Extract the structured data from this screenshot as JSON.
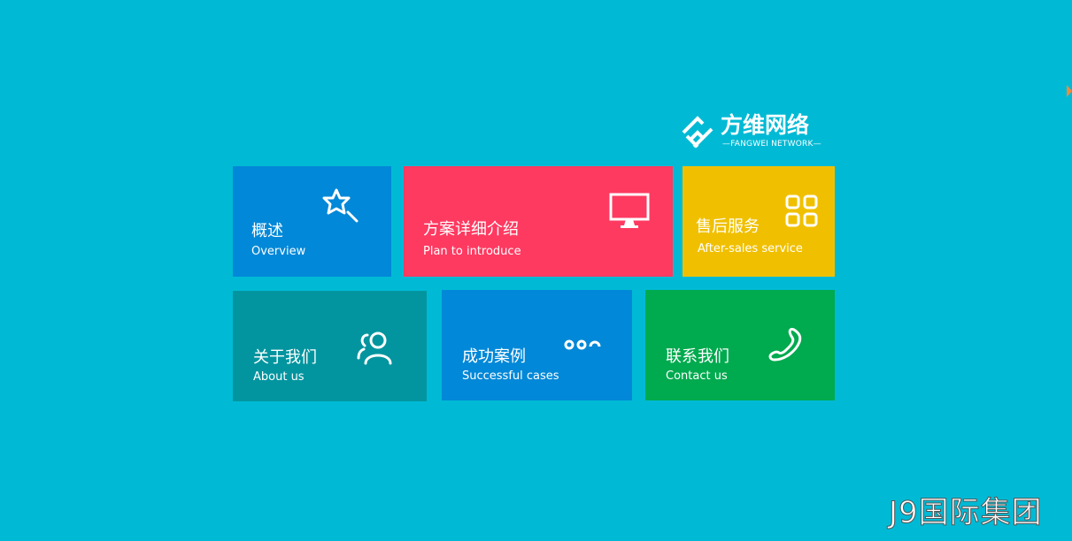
{
  "brand": {
    "name_cn": "方维网络",
    "name_en": "—FANGWEI NETWORK—",
    "accent_color": "#00bad5"
  },
  "tiles": [
    {
      "title": "概述",
      "subtitle": "Overview",
      "icon": "star-magnifier-icon",
      "color": "#0288d8"
    },
    {
      "title": "方案详细介绍",
      "subtitle": "Plan to introduce",
      "icon": "monitor-icon",
      "color": "#fe3a61"
    },
    {
      "title": "售后服务",
      "subtitle": "After-sales service",
      "icon": "grid-apps-icon",
      "color": "#f0c000"
    },
    {
      "title": "关于我们",
      "subtitle": "About us",
      "icon": "users-icon",
      "color": "#03959f"
    },
    {
      "title": "成功案例",
      "subtitle": "Successful cases",
      "icon": "dots-icon",
      "color": "#0288d8"
    },
    {
      "title": "联系我们",
      "subtitle": "Contact us",
      "icon": "phone-icon",
      "color": "#00aa4e"
    }
  ],
  "watermark": {
    "text": "J9国际集团"
  }
}
